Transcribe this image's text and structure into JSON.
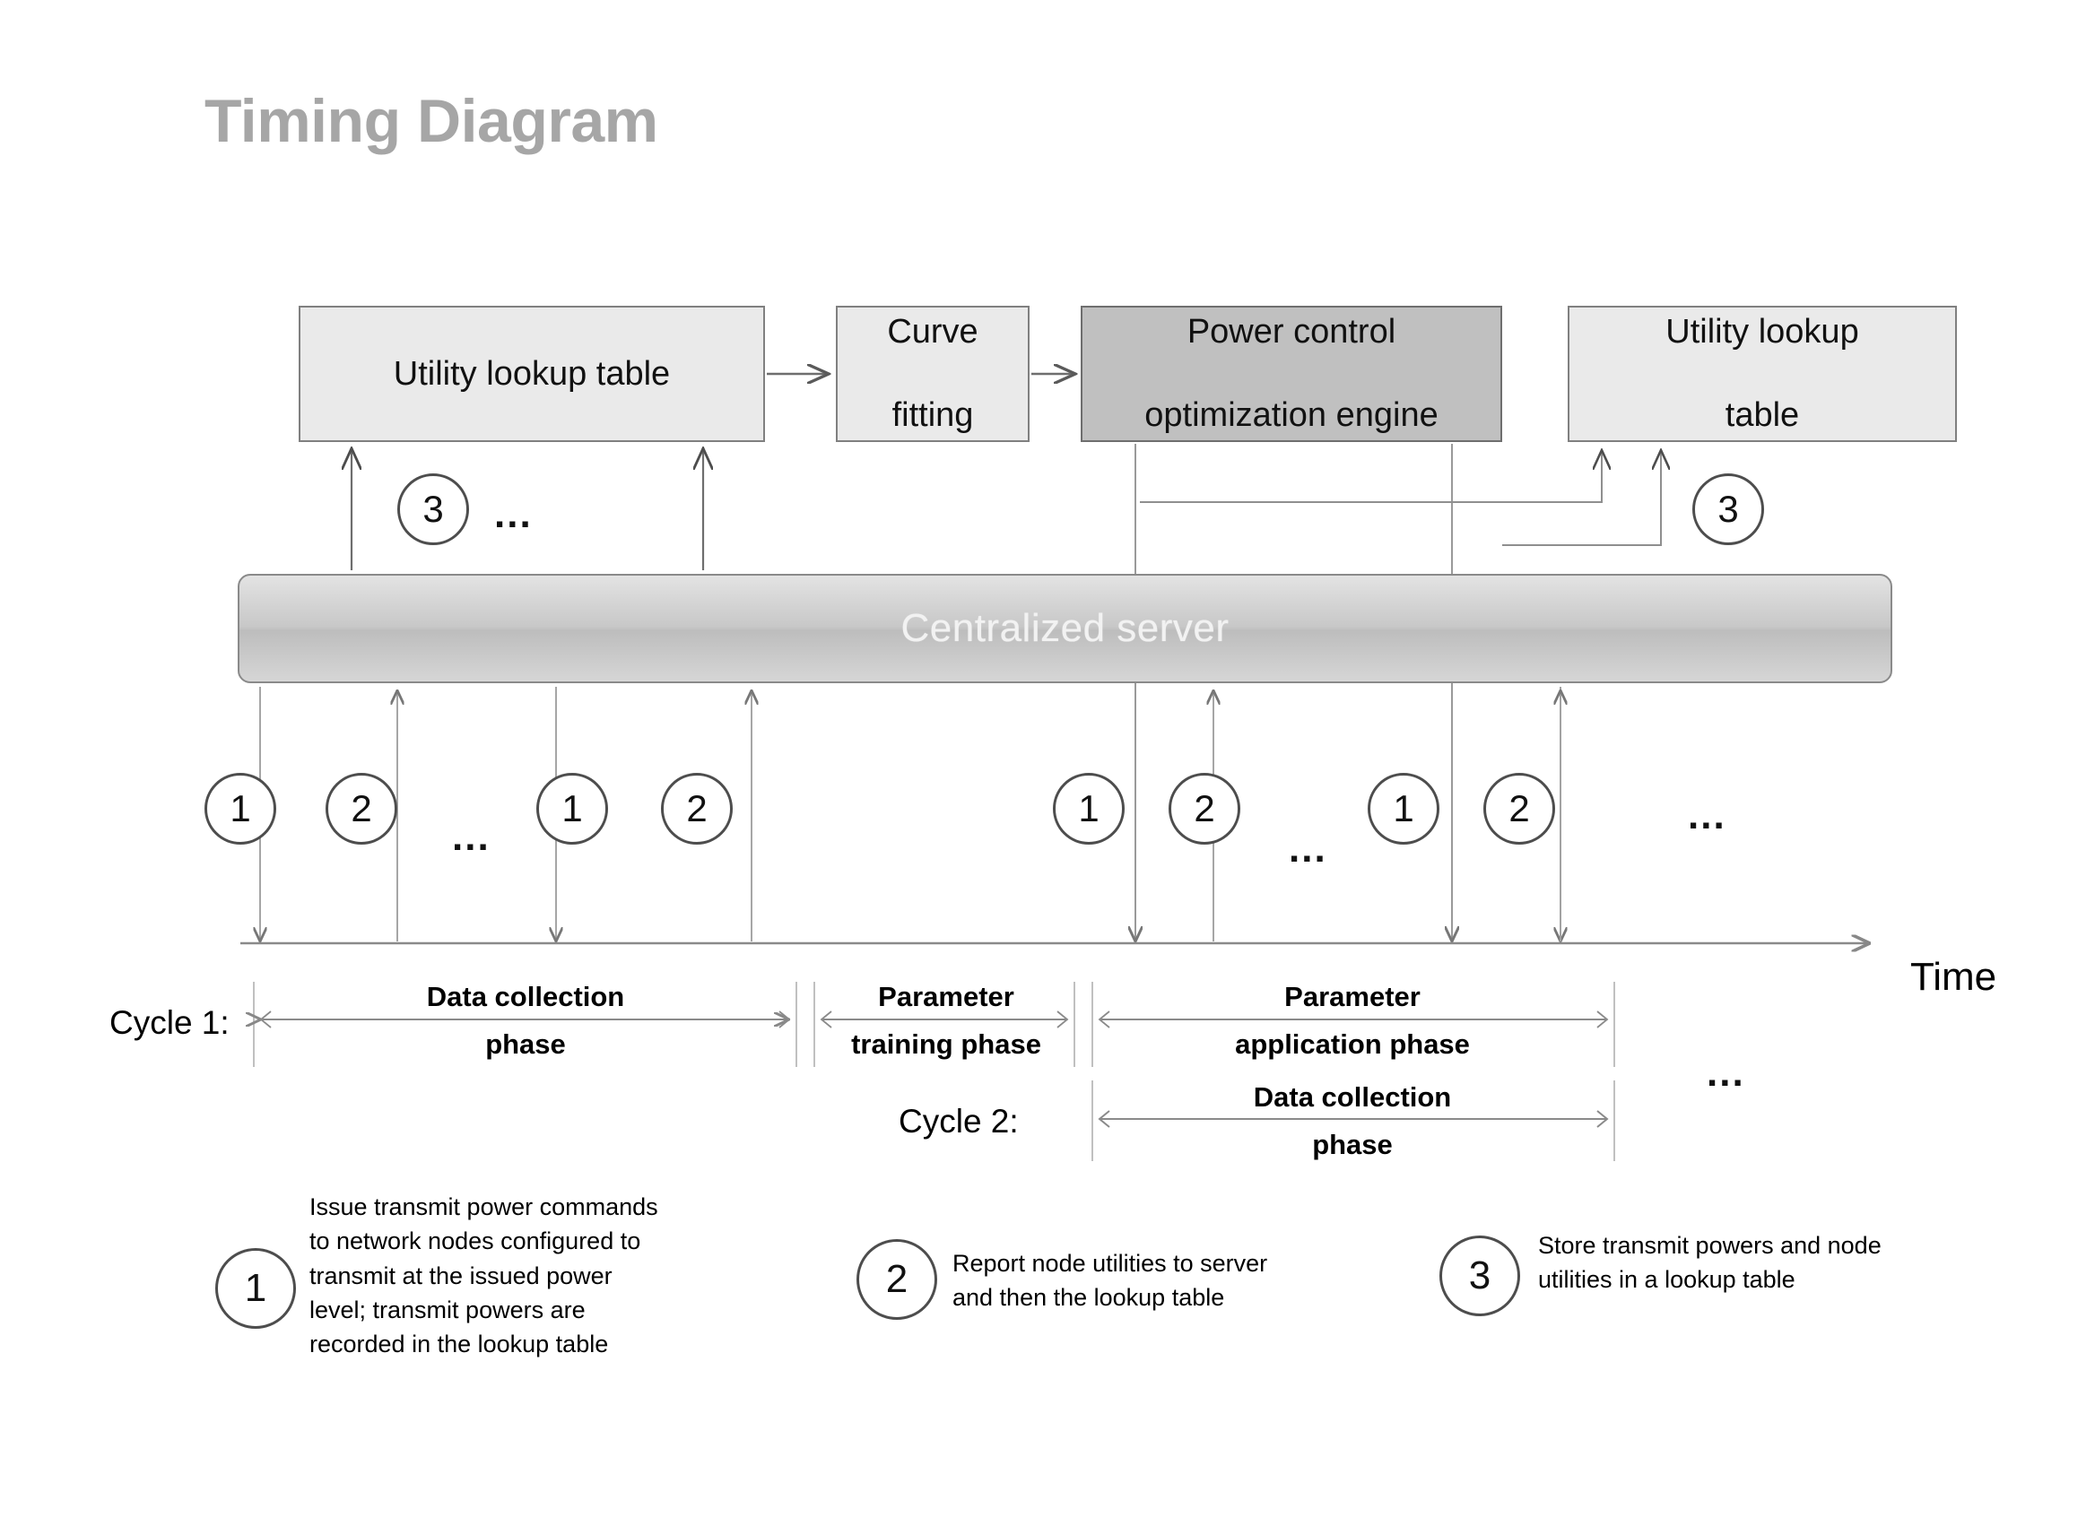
{
  "title": "Timing Diagram",
  "boxes": [
    {
      "id": "lut1",
      "label": "Utility lookup table",
      "fill": "#eaeaea"
    },
    {
      "id": "curve",
      "label": "Curve\nfitting",
      "fill": "#eaeaea"
    },
    {
      "id": "pco",
      "label": "Power control\noptimization engine",
      "fill": "#c0c0c0"
    },
    {
      "id": "lut2",
      "label": "Utility lookup\ntable",
      "fill": "#eaeaea"
    }
  ],
  "box_labels": {
    "lut1": "Utility lookup table",
    "curve_line1": "Curve",
    "curve_line2": "fitting",
    "pco_line1": "Power control",
    "pco_line2": "optimization engine",
    "lut2_line1": "Utility lookup",
    "lut2_line2": "table"
  },
  "server": {
    "label": "Centralized server",
    "fill": "#c8c8c8"
  },
  "step_markers_top": {
    "number": "3",
    "ellipsis": "..."
  },
  "step_markers_right": {
    "number": "3"
  },
  "sequence_row": [
    {
      "number": "1"
    },
    {
      "number": "2"
    },
    {
      "ellipsis": "..."
    },
    {
      "number": "1"
    },
    {
      "number": "2"
    },
    {
      "number": "1"
    },
    {
      "number": "2"
    },
    {
      "ellipsis": "..."
    },
    {
      "number": "1"
    },
    {
      "number": "2"
    },
    {
      "ellipsis": "..."
    }
  ],
  "axis": {
    "time_label": "Time"
  },
  "cycles": [
    {
      "name": "Cycle 1:",
      "phases": [
        {
          "line1": "Data collection",
          "line2": "phase"
        },
        {
          "line1": "Parameter",
          "line2": "training phase"
        },
        {
          "line1": "Parameter",
          "line2": "application phase"
        }
      ],
      "trailing_ellipsis": "..."
    },
    {
      "name": "Cycle 2:",
      "phases": [
        {
          "line1": "Data collection",
          "line2": "phase"
        }
      ]
    }
  ],
  "legend": [
    {
      "number": "1",
      "lines": [
        "Issue transmit power commands",
        "to network nodes configured to",
        "transmit at the issued power",
        "level; transmit powers are",
        "recorded in the lookup table"
      ]
    },
    {
      "number": "2",
      "lines": [
        "Report node utilities  to server",
        "and then the lookup table"
      ]
    },
    {
      "number": "3",
      "lines": [
        "Store transmit powers and node",
        "utilities in a lookup table"
      ]
    }
  ],
  "colors": {
    "title": "#a6a6a6",
    "box_border": "#808080",
    "box_fill_light": "#eaeaea",
    "box_fill_dark": "#c0c0c0",
    "server_fill": "#c8c8c8",
    "server_text": "#f2f2f2",
    "line": "#5a5a5a",
    "text": "#000000"
  }
}
